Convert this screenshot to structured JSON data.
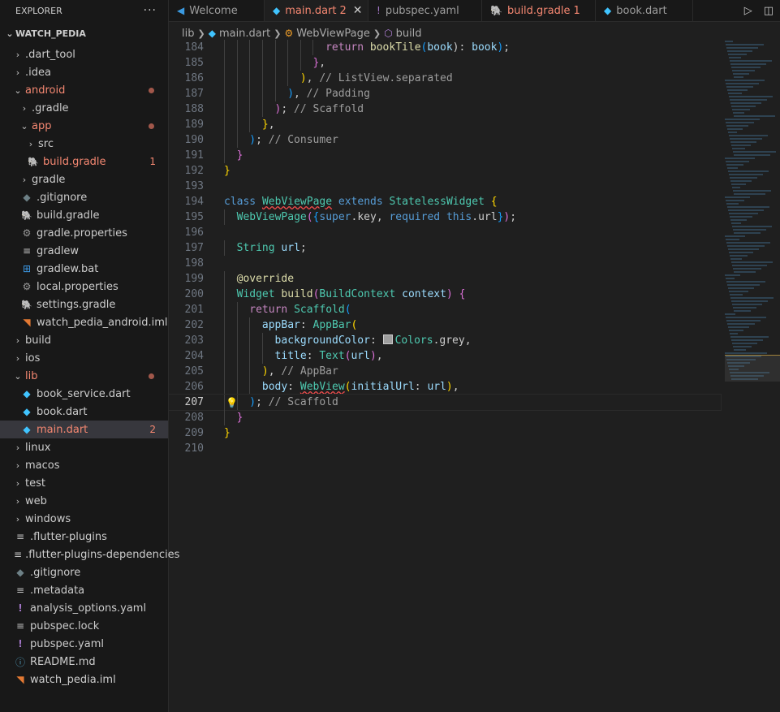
{
  "sidebar": {
    "title": "EXPLORER",
    "more": "···",
    "project": "WATCH_PEDIA",
    "items": [
      {
        "label": ".dart_tool",
        "depth": 1,
        "kind": "folder",
        "expanded": false
      },
      {
        "label": ".idea",
        "depth": 1,
        "kind": "folder",
        "expanded": false
      },
      {
        "label": "android",
        "depth": 1,
        "kind": "folder",
        "expanded": true,
        "modified": true,
        "dot": true
      },
      {
        "label": ".gradle",
        "depth": 2,
        "kind": "folder",
        "expanded": false
      },
      {
        "label": "app",
        "depth": 2,
        "kind": "folder",
        "expanded": true,
        "modified": true,
        "dot": true
      },
      {
        "label": "src",
        "depth": 3,
        "kind": "folder",
        "expanded": false
      },
      {
        "label": "build.gradle",
        "depth": 3,
        "kind": "gradle",
        "modified": true,
        "badge": "1"
      },
      {
        "label": "gradle",
        "depth": 2,
        "kind": "folder",
        "expanded": false
      },
      {
        "label": ".gitignore",
        "depth": 2,
        "kind": "git"
      },
      {
        "label": "build.gradle",
        "depth": 2,
        "kind": "gradle"
      },
      {
        "label": "gradle.properties",
        "depth": 2,
        "kind": "gear"
      },
      {
        "label": "gradlew",
        "depth": 2,
        "kind": "lines"
      },
      {
        "label": "gradlew.bat",
        "depth": 2,
        "kind": "windows"
      },
      {
        "label": "local.properties",
        "depth": 2,
        "kind": "gear"
      },
      {
        "label": "settings.gradle",
        "depth": 2,
        "kind": "gradle"
      },
      {
        "label": "watch_pedia_android.iml",
        "depth": 2,
        "kind": "rss"
      },
      {
        "label": "build",
        "depth": 1,
        "kind": "folder",
        "expanded": false
      },
      {
        "label": "ios",
        "depth": 1,
        "kind": "folder",
        "expanded": false
      },
      {
        "label": "lib",
        "depth": 1,
        "kind": "folder",
        "expanded": true,
        "modified": true,
        "dot": true
      },
      {
        "label": "book_service.dart",
        "depth": 2,
        "kind": "dart"
      },
      {
        "label": "book.dart",
        "depth": 2,
        "kind": "dart"
      },
      {
        "label": "main.dart",
        "depth": 2,
        "kind": "dart",
        "modified": true,
        "badge": "2",
        "selected": true
      },
      {
        "label": "linux",
        "depth": 1,
        "kind": "folder",
        "expanded": false
      },
      {
        "label": "macos",
        "depth": 1,
        "kind": "folder",
        "expanded": false
      },
      {
        "label": "test",
        "depth": 1,
        "kind": "folder",
        "expanded": false
      },
      {
        "label": "web",
        "depth": 1,
        "kind": "folder",
        "expanded": false
      },
      {
        "label": "windows",
        "depth": 1,
        "kind": "folder",
        "expanded": false
      },
      {
        "label": ".flutter-plugins",
        "depth": 1,
        "kind": "lines"
      },
      {
        "label": ".flutter-plugins-dependencies",
        "depth": 1,
        "kind": "lines"
      },
      {
        "label": ".gitignore",
        "depth": 1,
        "kind": "git"
      },
      {
        "label": ".metadata",
        "depth": 1,
        "kind": "lines"
      },
      {
        "label": "analysis_options.yaml",
        "depth": 1,
        "kind": "yaml"
      },
      {
        "label": "pubspec.lock",
        "depth": 1,
        "kind": "lines"
      },
      {
        "label": "pubspec.yaml",
        "depth": 1,
        "kind": "yaml"
      },
      {
        "label": "README.md",
        "depth": 1,
        "kind": "info"
      },
      {
        "label": "watch_pedia.iml",
        "depth": 1,
        "kind": "rss"
      }
    ]
  },
  "tabs": [
    {
      "label": "Welcome",
      "icon": "vscode",
      "active": false
    },
    {
      "label": "main.dart",
      "icon": "dart",
      "active": true,
      "badge": "2",
      "modified": true
    },
    {
      "label": "pubspec.yaml",
      "icon": "yaml",
      "active": false
    },
    {
      "label": "build.gradle",
      "icon": "gradle",
      "active": false,
      "badge": "1",
      "modified": true
    },
    {
      "label": "book.dart",
      "icon": "dart",
      "active": false
    }
  ],
  "breadcrumb": [
    "lib",
    "main.dart",
    "WebViewPage",
    "build"
  ],
  "editor": {
    "current_line": 207,
    "lines": [
      {
        "n": 184,
        "indent": 8,
        "tokens": [
          [
            "kc",
            "return "
          ],
          [
            "fn",
            "bookTile"
          ],
          [
            "p3",
            "("
          ],
          [
            "pr",
            "book"
          ],
          [
            "",
            "): "
          ],
          [
            "pr",
            "book"
          ],
          [
            "p3",
            ")"
          ],
          [
            "",
            ";"
          ]
        ]
      },
      {
        "n": 185,
        "indent": 7,
        "tokens": [
          [
            "p2",
            "}"
          ],
          [
            "",
            ","
          ]
        ]
      },
      {
        "n": 186,
        "indent": 6,
        "tokens": [
          [
            "p1",
            ")"
          ],
          [
            "",
            ", "
          ],
          [
            "cm",
            "// ListView.separated"
          ]
        ]
      },
      {
        "n": 187,
        "indent": 5,
        "tokens": [
          [
            "p3",
            ")"
          ],
          [
            "",
            ", "
          ],
          [
            "cm",
            "// Padding"
          ]
        ]
      },
      {
        "n": 188,
        "indent": 4,
        "tokens": [
          [
            "p2",
            ")"
          ],
          [
            "",
            "; "
          ],
          [
            "cm",
            "// Scaffold"
          ]
        ]
      },
      {
        "n": 189,
        "indent": 3,
        "tokens": [
          [
            "p1",
            "}"
          ],
          [
            "",
            ","
          ]
        ]
      },
      {
        "n": 190,
        "indent": 2,
        "tokens": [
          [
            "p3",
            ")"
          ],
          [
            "",
            "; "
          ],
          [
            "cm",
            "// Consumer"
          ]
        ]
      },
      {
        "n": 191,
        "indent": 1,
        "tokens": [
          [
            "p2",
            "}"
          ]
        ]
      },
      {
        "n": 192,
        "indent": 0,
        "tokens": [
          [
            "p1",
            "}"
          ]
        ]
      },
      {
        "n": 193,
        "indent": 0,
        "tokens": []
      },
      {
        "n": 194,
        "indent": 0,
        "tokens": [
          [
            "k",
            "class "
          ],
          [
            "ty squig",
            "WebViewPage"
          ],
          [
            "k",
            " extends "
          ],
          [
            "ty",
            "StatelessWidget "
          ],
          [
            "p1",
            "{"
          ]
        ]
      },
      {
        "n": 195,
        "indent": 1,
        "tokens": [
          [
            "ty",
            "WebViewPage"
          ],
          [
            "p2",
            "("
          ],
          [
            "p3",
            "{"
          ],
          [
            "k",
            "super"
          ],
          [
            "",
            ".key, "
          ],
          [
            "k",
            "required "
          ],
          [
            "k",
            "this"
          ],
          [
            "",
            ".url"
          ],
          [
            "p3",
            "}"
          ],
          [
            "p2",
            ")"
          ],
          [
            "",
            ";"
          ]
        ]
      },
      {
        "n": 196,
        "indent": 0,
        "tokens": []
      },
      {
        "n": 197,
        "indent": 1,
        "tokens": [
          [
            "ty",
            "String "
          ],
          [
            "pr",
            "url"
          ],
          [
            "",
            ";"
          ]
        ]
      },
      {
        "n": 198,
        "indent": 0,
        "tokens": []
      },
      {
        "n": 199,
        "indent": 1,
        "tokens": [
          [
            "an",
            "@override"
          ]
        ]
      },
      {
        "n": 200,
        "indent": 1,
        "tokens": [
          [
            "ty",
            "Widget "
          ],
          [
            "fn",
            "build"
          ],
          [
            "p2",
            "("
          ],
          [
            "ty",
            "BuildContext "
          ],
          [
            "pr",
            "context"
          ],
          [
            "p2",
            ")"
          ],
          [
            "p2",
            " {"
          ]
        ]
      },
      {
        "n": 201,
        "indent": 2,
        "tokens": [
          [
            "kc",
            "return "
          ],
          [
            "ty",
            "Scaffold"
          ],
          [
            "p3",
            "("
          ]
        ]
      },
      {
        "n": 202,
        "indent": 3,
        "tokens": [
          [
            "pr",
            "appBar"
          ],
          [
            "",
            ": "
          ],
          [
            "ty",
            "AppBar"
          ],
          [
            "p1",
            "("
          ]
        ]
      },
      {
        "n": 203,
        "indent": 4,
        "tokens": [
          [
            "pr",
            "backgroundColor"
          ],
          [
            "",
            ": "
          ],
          [
            "swatch",
            ""
          ],
          [
            "ty",
            "Colors"
          ],
          [
            "",
            ".grey,"
          ]
        ]
      },
      {
        "n": 204,
        "indent": 4,
        "tokens": [
          [
            "pr",
            "title"
          ],
          [
            "",
            ": "
          ],
          [
            "ty",
            "Text"
          ],
          [
            "p2",
            "("
          ],
          [
            "pr",
            "url"
          ],
          [
            "p2",
            ")"
          ],
          [
            "",
            ","
          ]
        ]
      },
      {
        "n": 205,
        "indent": 3,
        "tokens": [
          [
            "p1",
            ")"
          ],
          [
            "",
            ", "
          ],
          [
            "cm",
            "// AppBar"
          ]
        ]
      },
      {
        "n": 206,
        "indent": 3,
        "tokens": [
          [
            "pr",
            "body"
          ],
          [
            "",
            ": "
          ],
          [
            "ty squig",
            "WebView"
          ],
          [
            "p1",
            "("
          ],
          [
            "pr",
            "initialUrl"
          ],
          [
            "",
            ": "
          ],
          [
            "pr",
            "url"
          ],
          [
            "p1",
            ")"
          ],
          [
            "",
            ","
          ]
        ]
      },
      {
        "n": 207,
        "indent": 2,
        "tokens": [
          [
            "p3",
            ")"
          ],
          [
            "",
            "; "
          ],
          [
            "cm",
            "// Scaffold"
          ]
        ],
        "bulb": true
      },
      {
        "n": 208,
        "indent": 1,
        "tokens": [
          [
            "p2",
            "}"
          ]
        ]
      },
      {
        "n": 209,
        "indent": 0,
        "tokens": [
          [
            "p1",
            "}"
          ]
        ]
      },
      {
        "n": 210,
        "indent": 0,
        "tokens": []
      }
    ]
  }
}
